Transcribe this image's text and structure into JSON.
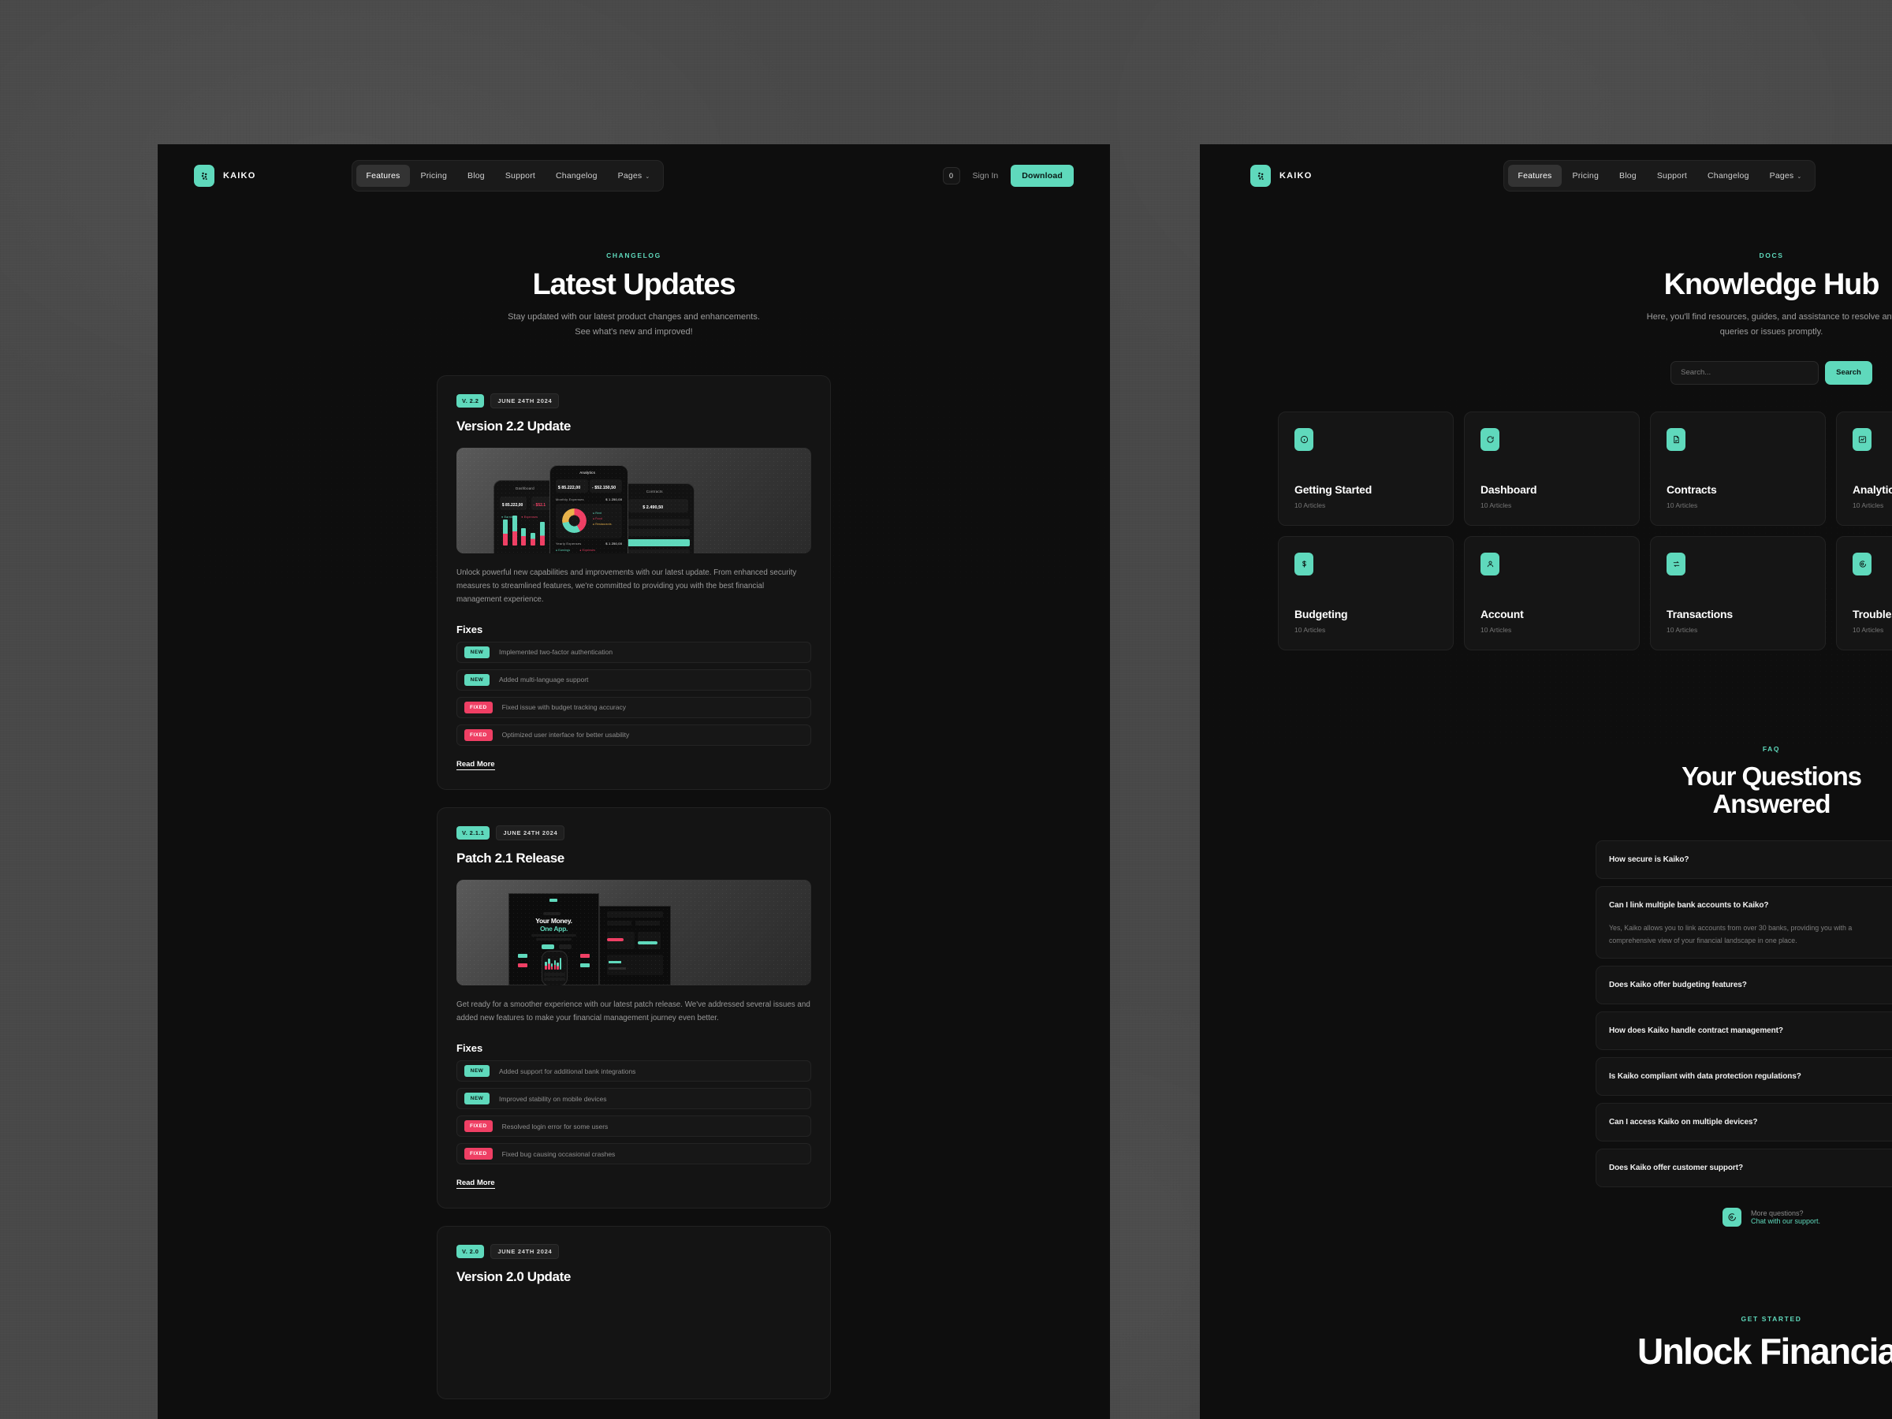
{
  "brand": {
    "name": "KAIKO",
    "logo_icon": "kaiko-hash-logo"
  },
  "accent": {
    "teal": "#5FD9BC",
    "red": "#EF3F64",
    "panel_bg": "#0E0E0E",
    "card_bg": "#141414"
  },
  "nav": {
    "links": [
      {
        "label": "Features",
        "active": true
      },
      {
        "label": "Pricing",
        "active": false
      },
      {
        "label": "Blog",
        "active": false
      },
      {
        "label": "Support",
        "active": false
      },
      {
        "label": "Changelog",
        "active": false
      },
      {
        "label": "Pages",
        "active": false,
        "caret": "⌄"
      }
    ],
    "cart_count": "0",
    "signin_label": "Sign In",
    "download_label": "Download"
  },
  "left_page": {
    "hero": {
      "eyebrow": "CHANGELOG",
      "title": "Latest Updates",
      "subtitle": "Stay updated with our latest product changes and enhancements. See what's new and improved!"
    },
    "fixes_heading": "Fixes",
    "read_more": "Read More",
    "releases": [
      {
        "version": "V. 2.2",
        "date": "JUNE 24TH 2024",
        "title": "Version 2.2 Update",
        "image": "three-phone-dashboard-analytics-contracts-mockup",
        "body": "Unlock powerful new capabilities and improvements with our latest update. From enhanced security measures to streamlined features, we're committed to providing you with the best financial management experience.",
        "fixes": [
          {
            "tag": "NEW",
            "text": "Implemented two-factor authentication"
          },
          {
            "tag": "NEW",
            "text": "Added multi-language support"
          },
          {
            "tag": "FIXED",
            "text": "Fixed issue with budget tracking accuracy"
          },
          {
            "tag": "FIXED",
            "text": "Optimized user interface for better usability"
          }
        ]
      },
      {
        "version": "V. 2.1.1",
        "date": "JUNE 24TH 2024",
        "title": "Patch 2.1 Release",
        "image": "landing-page-desktop-mockup",
        "image_headline_1": "Your Money.",
        "image_headline_2": "One App.",
        "body": "Get ready for a smoother experience with our latest patch release. We've addressed several issues and added new features to make your financial management journey even better.",
        "fixes": [
          {
            "tag": "NEW",
            "text": "Added support for additional bank integrations"
          },
          {
            "tag": "NEW",
            "text": "Improved stability on mobile devices"
          },
          {
            "tag": "FIXED",
            "text": "Resolved login error for some users"
          },
          {
            "tag": "FIXED",
            "text": "Fixed bug causing occasional crashes"
          }
        ]
      },
      {
        "version": "V. 2.0",
        "date": "JUNE 24TH 2024",
        "title": "Version 2.0 Update"
      }
    ]
  },
  "right_page": {
    "hero": {
      "eyebrow": "DOCS",
      "title": "Knowledge Hub",
      "subtitle": "Here, you'll find resources, guides, and assistance to resolve any queries or issues promptly."
    },
    "search": {
      "placeholder": "Search...",
      "value": "",
      "button_label": "Search"
    },
    "categories": [
      {
        "name": "Getting Started",
        "count": "10 Articles",
        "icon": "info-circle-icon"
      },
      {
        "name": "Dashboard",
        "count": "10 Articles",
        "icon": "refresh-icon"
      },
      {
        "name": "Contracts",
        "count": "10 Articles",
        "icon": "document-check-icon"
      },
      {
        "name": "Analytics",
        "count": "10 Articles",
        "icon": "chart-line-icon"
      },
      {
        "name": "Budgeting",
        "count": "10 Articles",
        "icon": "dollar-icon"
      },
      {
        "name": "Account",
        "count": "10 Articles",
        "icon": "user-icon"
      },
      {
        "name": "Transactions",
        "count": "10 Articles",
        "icon": "transfer-icon"
      },
      {
        "name": "Troubleshooting",
        "count": "10 Articles",
        "icon": "chat-help-icon"
      }
    ],
    "faq": {
      "eyebrow": "FAQ",
      "title": "Your Questions Answered",
      "items": [
        {
          "question": "How secure is Kaiko?",
          "answer": "",
          "expanded": false
        },
        {
          "question": "Can I link multiple bank accounts to Kaiko?",
          "answer": "Yes, Kaiko allows you to link accounts from over 30 banks, providing you with a comprehensive view of your financial landscape in one place.",
          "expanded": true
        },
        {
          "question": "Does Kaiko offer budgeting features?",
          "answer": "",
          "expanded": false
        },
        {
          "question": "How does Kaiko handle contract management?",
          "answer": "",
          "expanded": false
        },
        {
          "question": "Is Kaiko compliant with data protection regulations?",
          "answer": "",
          "expanded": false
        },
        {
          "question": "Can I access Kaiko on multiple devices?",
          "answer": "",
          "expanded": false
        },
        {
          "question": "Does Kaiko offer customer support?",
          "answer": "",
          "expanded": false
        }
      ],
      "toggle_symbol": "+",
      "support_line1": "More questions?",
      "support_line2": "Chat with our support.",
      "support_icon": "chat-bubble-icon"
    },
    "cta": {
      "eyebrow": "GET STARTED",
      "title": "Unlock Financial"
    }
  }
}
